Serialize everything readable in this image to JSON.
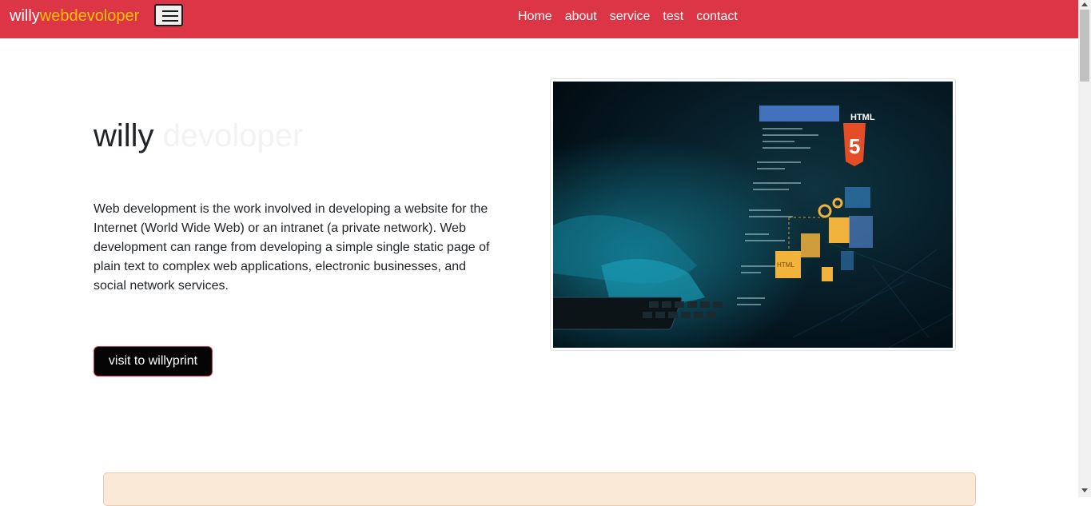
{
  "navbar": {
    "brand_main": "willy",
    "brand_accent": "webdevoloper",
    "links": [
      "Home",
      "about",
      "service",
      "test",
      "contact"
    ],
    "bg_color": "#dc3545",
    "accent_color": "#ffc107",
    "toggler_icon": "hamburger-menu-icon"
  },
  "hero": {
    "title_main": "willy",
    "title_faded": "devoloper",
    "paragraph": "Web development is the work involved in developing a website for the Internet (World Wide Web) or an intranet (a private network). Web development can range from developing a simple single static page of plain text to complex web applications, electronic businesses, and social network services.",
    "button_label": "visit to willyprint",
    "image_text": {
      "html_label": "HTML",
      "html_number": "5",
      "html_tag": "HTML"
    }
  }
}
